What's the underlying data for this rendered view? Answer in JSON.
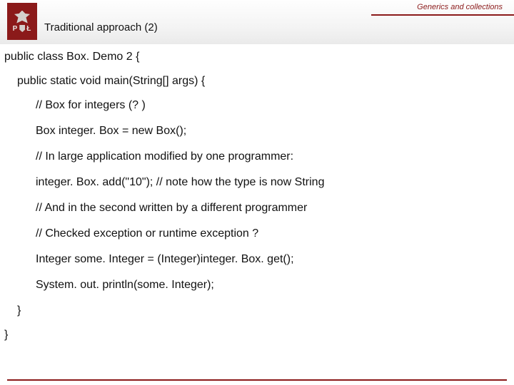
{
  "header": {
    "topic": "Generics and collections",
    "title": "Traditional approach (2)",
    "logo_left": "P",
    "logo_right": "Ł"
  },
  "code": {
    "line1": "public class Box. Demo 2 {",
    "line2": "public static void main(String[] args) {",
    "line3": "// Box for integers (? )",
    "line4": "Box integer. Box = new Box();",
    "line5": "// In large application modified by one programmer:",
    "line6": "integer. Box. add(\"10\"); // note how the type is now String",
    "line7": "// And in the second written by a different programmer",
    "line8": "// Checked exception or runtime exception ?",
    "line9": "Integer some. Integer = (Integer)integer. Box. get();",
    "line10": "System. out. println(some. Integer);",
    "line11": "}",
    "line12": "}"
  }
}
